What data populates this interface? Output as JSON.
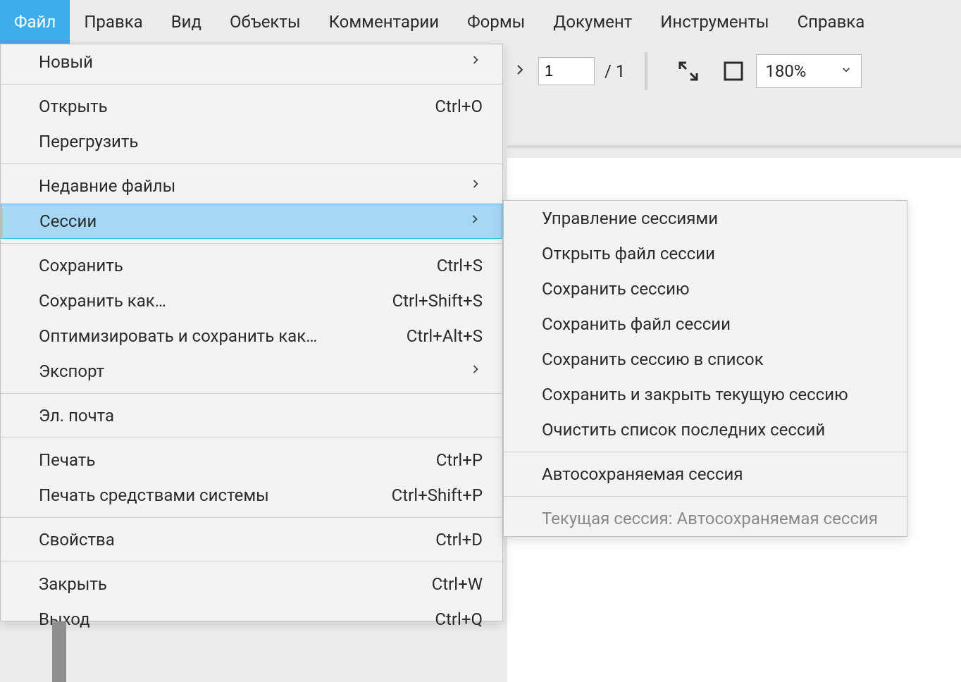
{
  "menubar": {
    "items": [
      {
        "label": "Файл",
        "active": true
      },
      {
        "label": "Правка"
      },
      {
        "label": "Вид"
      },
      {
        "label": "Объекты"
      },
      {
        "label": "Комментарии"
      },
      {
        "label": "Формы"
      },
      {
        "label": "Документ"
      },
      {
        "label": "Инструменты"
      },
      {
        "label": "Справка"
      }
    ]
  },
  "toolbar": {
    "page_value": "1",
    "page_total": "/ 1",
    "zoom_value": "180%"
  },
  "file_menu": {
    "items": [
      {
        "label": "Новый",
        "submenu": true
      },
      {
        "sep": true
      },
      {
        "label": "Открыть",
        "shortcut": "Ctrl+O"
      },
      {
        "label": "Перегрузить"
      },
      {
        "sep": true
      },
      {
        "label": "Недавние файлы",
        "submenu": true
      },
      {
        "label": "Сессии",
        "submenu": true,
        "highlight": true
      },
      {
        "sep": true
      },
      {
        "label": "Сохранить",
        "shortcut": "Ctrl+S"
      },
      {
        "label": "Сохранить как…",
        "shortcut": "Ctrl+Shift+S"
      },
      {
        "label": "Оптимизировать и сохранить как…",
        "shortcut": "Ctrl+Alt+S"
      },
      {
        "label": "Экспорт",
        "submenu": true
      },
      {
        "sep": true
      },
      {
        "label": "Эл. почта"
      },
      {
        "sep": true
      },
      {
        "label": "Печать",
        "shortcut": "Ctrl+P"
      },
      {
        "label": "Печать средствами системы",
        "shortcut": "Ctrl+Shift+P"
      },
      {
        "sep": true
      },
      {
        "label": "Свойства",
        "shortcut": "Ctrl+D"
      },
      {
        "sep": true
      },
      {
        "label": "Закрыть",
        "shortcut": "Ctrl+W"
      },
      {
        "label": "Выход",
        "shortcut": "Ctrl+Q"
      }
    ]
  },
  "sessions_menu": {
    "items": [
      {
        "label": "Управление сессиями"
      },
      {
        "label": "Открыть файл сессии"
      },
      {
        "label": "Сохранить сессию"
      },
      {
        "label": "Сохранить файл сессии"
      },
      {
        "label": "Сохранить сессию в список"
      },
      {
        "label": "Сохранить и закрыть текущую сессию"
      },
      {
        "label": "Очистить список последних сессий"
      },
      {
        "sep": true
      },
      {
        "label": "Автосохраняемая сессия"
      },
      {
        "sep": true
      },
      {
        "label": "Текущая сессия: Автосохраняемая сессия",
        "disabled": true
      }
    ]
  }
}
